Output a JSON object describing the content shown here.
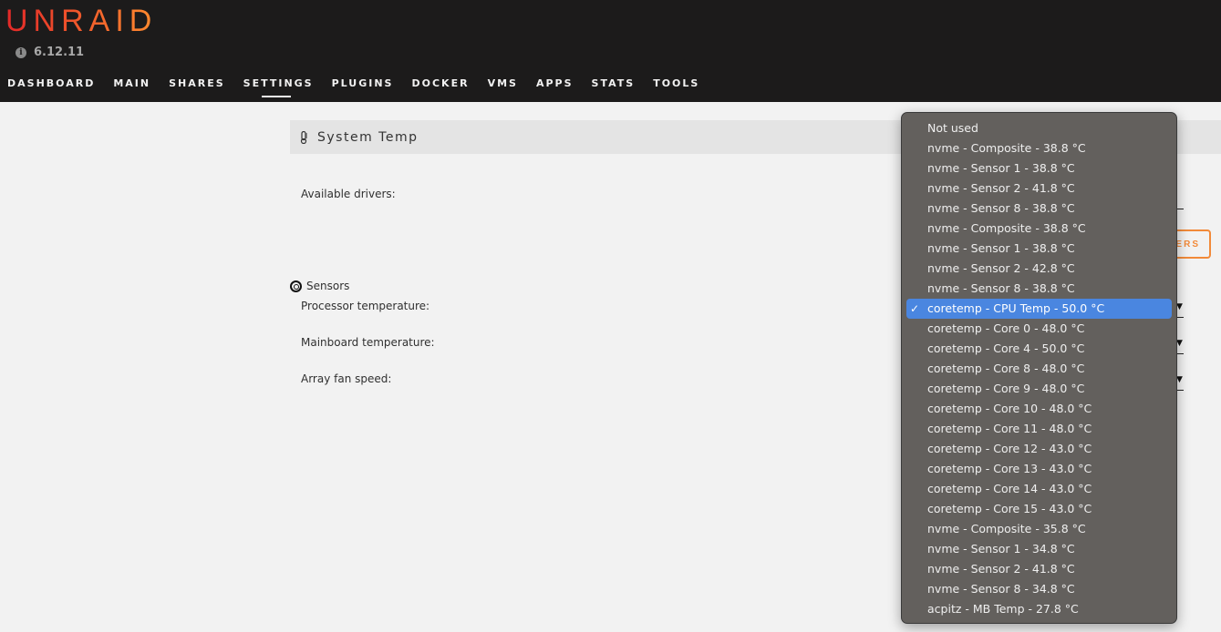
{
  "header": {
    "logo": "UNRAID",
    "version": "6.12.11",
    "version_icon": "info-icon",
    "nav": [
      {
        "label": "DASHBOARD",
        "active": false
      },
      {
        "label": "MAIN",
        "active": false
      },
      {
        "label": "SHARES",
        "active": false
      },
      {
        "label": "SETTINGS",
        "active": true
      },
      {
        "label": "PLUGINS",
        "active": false
      },
      {
        "label": "DOCKER",
        "active": false
      },
      {
        "label": "VMS",
        "active": false
      },
      {
        "label": "APPS",
        "active": false
      },
      {
        "label": "STATS",
        "active": false
      },
      {
        "label": "TOOLS",
        "active": false
      }
    ]
  },
  "section": {
    "icon": "thermometer-icon",
    "title": "System Temp"
  },
  "form": {
    "available_drivers_label": "Available drivers:",
    "drivers_button_visible_text": "VERS",
    "sensors_heading": "Sensors",
    "sensors_icon": "compass-icon",
    "processor_label": "Processor temperature:",
    "mainboard_label": "Mainboard temperature:",
    "fan_label": "Array fan speed:"
  },
  "dropdown": {
    "selected_index": 8,
    "check_glyph": "✓",
    "options": [
      "Not used",
      "nvme - Composite - 38.8 °C",
      "nvme - Sensor 1 - 38.8 °C",
      "nvme - Sensor 2 - 41.8 °C",
      "nvme - Sensor 8 - 38.8 °C",
      "nvme - Composite - 38.8 °C",
      "nvme - Sensor 1 - 38.8 °C",
      "nvme - Sensor 2 - 42.8 °C",
      "nvme - Sensor 8 - 38.8 °C",
      "coretemp - CPU Temp - 50.0 °C",
      "coretemp - Core 0 - 48.0 °C",
      "coretemp - Core 4 - 50.0 °C",
      "coretemp - Core 8 - 48.0 °C",
      "coretemp - Core 9 - 48.0 °C",
      "coretemp - Core 10 - 48.0 °C",
      "coretemp - Core 11 - 48.0 °C",
      "coretemp - Core 12 - 43.0 °C",
      "coretemp - Core 13 - 43.0 °C",
      "coretemp - Core 14 - 43.0 °C",
      "coretemp - Core 15 - 43.0 °C",
      "nvme - Composite - 35.8 °C",
      "nvme - Sensor 1 - 34.8 °C",
      "nvme - Sensor 2 - 41.8 °C",
      "nvme - Sensor 8 - 34.8 °C",
      "acpitz - MB Temp - 27.8 °C"
    ],
    "selected_label": "coretemp - CPU Temp - 50.0 °C"
  },
  "colors": {
    "header_bg": "#1c1b1b",
    "accent_orange": "#f28a39",
    "logo_red": "#e22828",
    "selection_blue": "#4a86e0",
    "dropdown_bg": "#63605d"
  }
}
